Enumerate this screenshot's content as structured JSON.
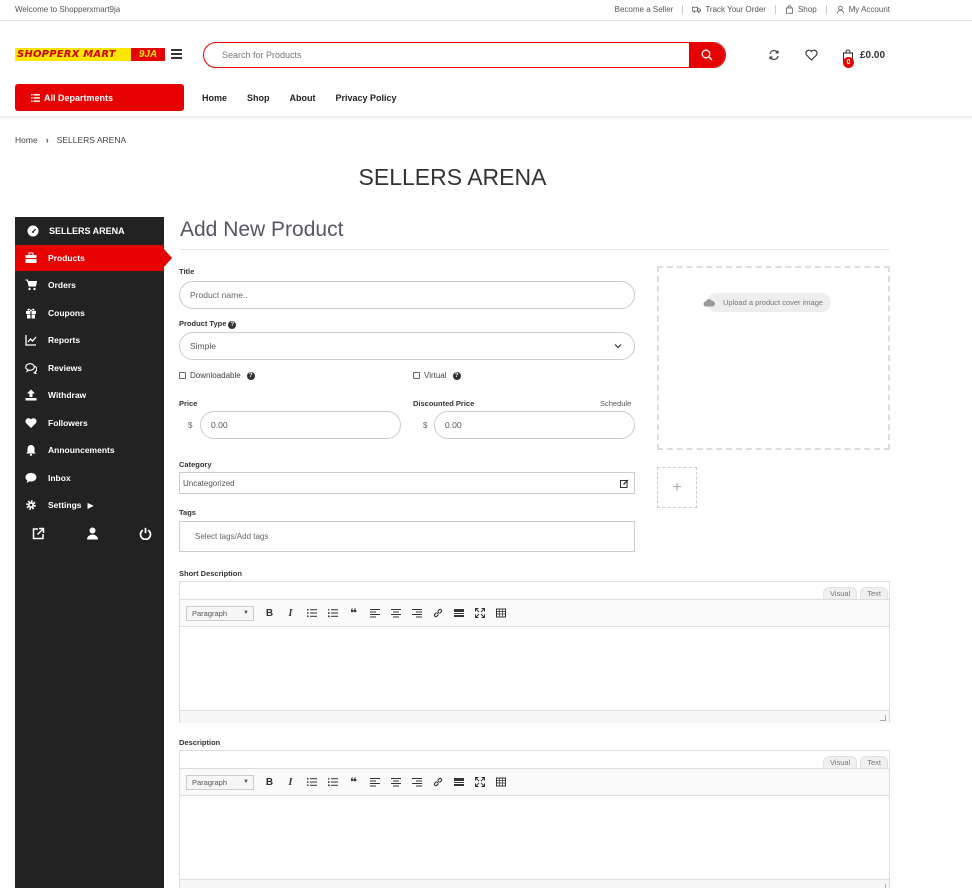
{
  "topbar": {
    "welcome": "Welcome to Shopperxmart9ja",
    "links": [
      "Become a Seller",
      "Track Your Order",
      "Shop",
      "My Account"
    ]
  },
  "header": {
    "logo_main": "SHOPPERX MART",
    "logo_tail": "9JA",
    "search_placeholder": "Search for Products",
    "cart_count": "0",
    "cart_total": "£0.00",
    "departments_label": "All Departments",
    "nav": [
      "Home",
      "Shop",
      "About",
      "Privacy Policy"
    ]
  },
  "breadcrumb": {
    "home": "Home",
    "current": "SELLERS ARENA"
  },
  "page_title": "SELLERS ARENA",
  "sidebar": {
    "header": "SELLERS ARENA",
    "items": [
      "Products",
      "Orders",
      "Coupons",
      "Reports",
      "Reviews",
      "Withdraw",
      "Followers",
      "Announcements",
      "Inbox",
      "Settings"
    ],
    "active": "Products"
  },
  "form": {
    "heading": "Add New Product",
    "title_label": "Title",
    "title_placeholder": "Product name..",
    "type_label": "Product Type",
    "type_value": "Simple",
    "downloadable_label": "Downloadable",
    "virtual_label": "Virtual",
    "price_label": "Price",
    "price_currency": "$",
    "price_value": "0.00",
    "discount_label": "Discounted Price",
    "schedule_label": "Schedule",
    "discount_currency": "$",
    "discount_value": "0.00",
    "category_label": "Category",
    "category_value": "Uncategorized",
    "tags_label": "Tags",
    "tags_placeholder": "Select tags/Add tags",
    "cover_label": "Upload a product cover image",
    "gallery_add": "+",
    "short_desc_label": "Short Description",
    "desc_label": "Description",
    "editor": {
      "visual": "Visual",
      "text": "Text",
      "format": "Paragraph"
    }
  },
  "colors": {
    "accent": "#e60000",
    "sidebar": "#222222",
    "logo_yellow": "#ffe600"
  }
}
